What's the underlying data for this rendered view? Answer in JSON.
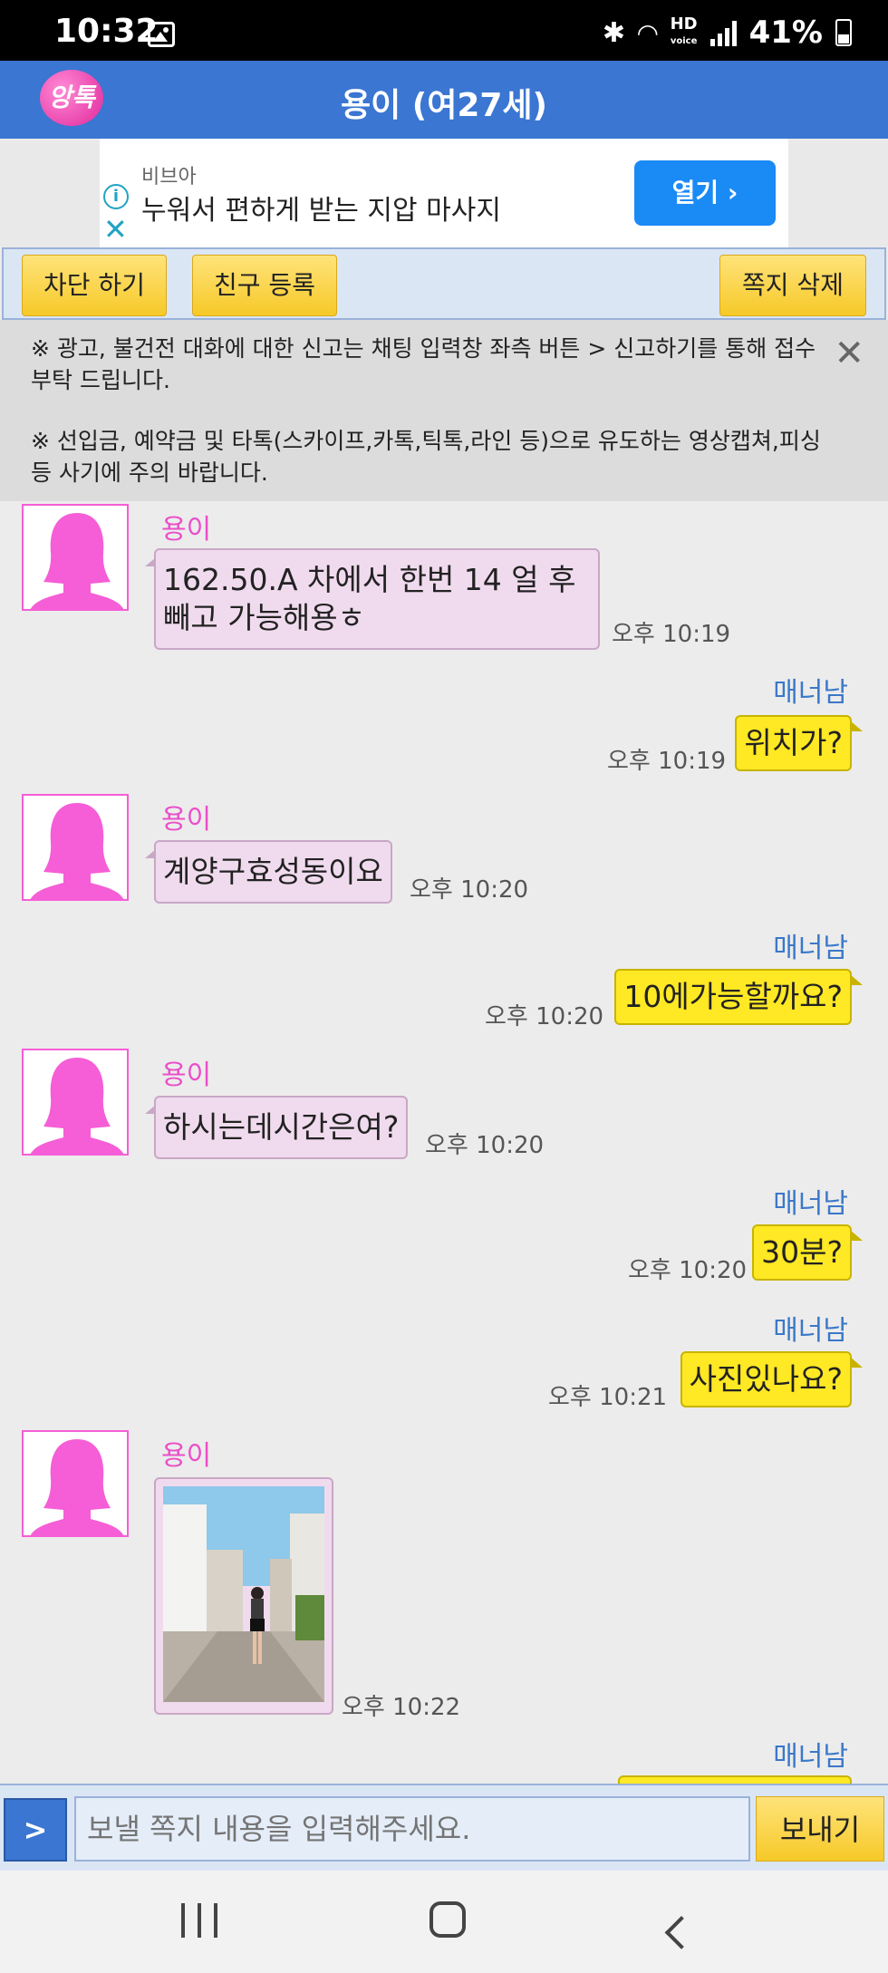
{
  "status_bar": {
    "time": "10:32",
    "battery": "41%",
    "hd_top": "HD",
    "hd_bottom": "voice"
  },
  "header": {
    "logo_text": "앙톡",
    "title": "용이 (여27세)"
  },
  "ad": {
    "brand": "비브아",
    "headline": "누워서 편하게 받는 지압 마사지",
    "open_label": "열기 ›"
  },
  "actions": {
    "block": "차단 하기",
    "add_friend": "친구 등록",
    "delete": "쪽지 삭제"
  },
  "notice": {
    "line1": "※ 광고, 불건전 대화에 대한 신고는 채팅 입력창 좌측 버튼 > 신고하기를 통해 접수 부탁 드립니다.",
    "line2": "※ 선입금, 예약금 및 타톡(스카이프,카톡,틱톡,라인 등)으로 유도하는 영상캡쳐,피싱 등 사기에 주의 바랍니다."
  },
  "chat": {
    "her_name": "용이",
    "my_name": "매너남",
    "messages": [
      {
        "from": "her",
        "text": "162.50.A 차에서 한번 14 얼 후 빼고 가능해용ㅎ",
        "time": "오후 10:19"
      },
      {
        "from": "me",
        "text": "위치가?",
        "time": "오후 10:19"
      },
      {
        "from": "her",
        "text": "계양구효성동이요",
        "time": "오후 10:20"
      },
      {
        "from": "me",
        "text": "10에가능할까요?",
        "time": "오후 10:20"
      },
      {
        "from": "her",
        "text": "하시는데시간은여?",
        "time": "오후 10:20"
      },
      {
        "from": "me",
        "text": "30분?",
        "time": "오후 10:20"
      },
      {
        "from": "me",
        "text": "사진있나요?",
        "time": "오후 10:21"
      },
      {
        "from": "her",
        "type": "photo",
        "time": "오후 10:22"
      }
    ]
  },
  "input": {
    "toggle": ">",
    "placeholder": "보낼 쪽지 내용을 입력해주세요.",
    "send": "보내기"
  },
  "colors": {
    "header": "#3a76d2",
    "her_bubble": "#f0dbee",
    "my_bubble": "#ffe824",
    "her_name": "#ea4fc9",
    "my_name": "#3a78c9"
  }
}
